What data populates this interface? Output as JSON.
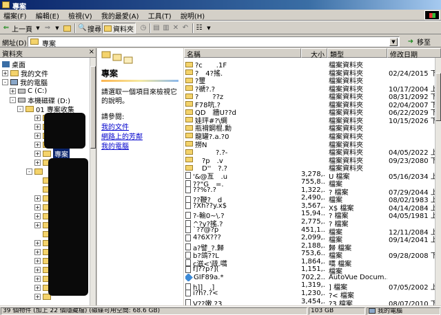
{
  "window": {
    "title": "專案"
  },
  "menu": [
    "檔案(F)",
    "編輯(E)",
    "檢視(V)",
    "我的最愛(A)",
    "工具(T)",
    "說明(H)"
  ],
  "toolbar": {
    "back": "上一頁",
    "search": "搜尋",
    "folders": "資料夾"
  },
  "address": {
    "label": "網址(D)",
    "value": "專案",
    "go": "移至"
  },
  "folder_pane": {
    "title": "資料夾",
    "tree": [
      {
        "label": "桌面",
        "expander": "",
        "selected": false
      },
      {
        "label": "我的文件",
        "expander": "+",
        "selected": false
      },
      {
        "label": "我的電腦",
        "expander": "-",
        "selected": false
      },
      {
        "label": "C (C:)",
        "expander": "+",
        "selected": false
      },
      {
        "label": "本機磁碟 (D:)",
        "expander": "-",
        "selected": false
      },
      {
        "label": "01 專案收集",
        "expander": "-",
        "selected": false
      },
      {
        "label": "專案",
        "expander": "+",
        "selected": true
      }
    ]
  },
  "info_pane": {
    "title": "專案",
    "description": "請選取一個項目來檢視它的說明。",
    "see_also": "請參閱:",
    "links": [
      "我的文件",
      "網路上的芳鄰",
      "我的電腦"
    ]
  },
  "list": {
    "columns": {
      "name": "名稱",
      "size": "大小",
      "type": "類型",
      "modified": "修改日期"
    },
    "rows": [
      {
        "icon": "folder",
        "name": "?c　　.1F",
        "size": "",
        "type": "檔案資料夾",
        "date": ""
      },
      {
        "icon": "folder",
        "name": "?　4?搖.",
        "size": "",
        "type": "檔案資料夾",
        "date": "02/24/2015 下"
      },
      {
        "icon": "folder",
        "name": "?璽",
        "size": "",
        "type": "檔案資料夾",
        "date": ""
      },
      {
        "icon": "folder",
        "name": "?褫?.?",
        "size": "",
        "type": "檔案資料夾",
        "date": "10/17/2004 上"
      },
      {
        "icon": "folder",
        "name": "?　　??z",
        "size": "",
        "type": "檔案資料夾",
        "date": "08/31/2092 下"
      },
      {
        "icon": "folder",
        "name": "F78吭.?",
        "size": "",
        "type": "檔案資料夾",
        "date": "02/04/2007 下"
      },
      {
        "icon": "folder",
        "name": "QD　牆U??d",
        "size": "",
        "type": "檔案資料夾",
        "date": "06/22/2029 下"
      },
      {
        "icon": "folder",
        "name": "娃玶#?\\綢",
        "size": "",
        "type": "檔案資料夾",
        "date": "10/15/2026 下"
      },
      {
        "icon": "folder",
        "name": "瓶褙鋼棍.勳",
        "size": "",
        "type": "檔案資料夾",
        "date": ""
      },
      {
        "icon": "folder",
        "name": "龍罐?.a.?0",
        "size": "",
        "type": "檔案資料夾",
        "date": ""
      },
      {
        "icon": "folder",
        "name": "撈N",
        "size": "",
        "type": "檔案資料夾",
        "date": ""
      },
      {
        "icon": "folder",
        "name": "　　　?.?-",
        "size": "",
        "type": "檔案資料夾",
        "date": "04/05/2022 上"
      },
      {
        "icon": "folder",
        "name": "　?p　.v",
        "size": "",
        "type": "檔案資料夾",
        "date": "09/23/2080 下"
      },
      {
        "icon": "folder",
        "name": "　D''　?.?",
        "size": "",
        "type": "檔案資料夾",
        "date": ""
      },
      {
        "icon": "file",
        "name": "'&@亙　.u",
        "size": "3,278,...",
        "type": "U 檔案",
        "date": "05/16/2034 上"
      },
      {
        "icon": "file",
        "name": "??\"G　=.",
        "size": "755,8...",
        "type": "檔案",
        "date": ""
      },
      {
        "icon": "file",
        "name": "??%?.?",
        "size": "1,322,...",
        "type": "? 檔案",
        "date": "07/29/2044 上"
      },
      {
        "icon": "file",
        "name": "??鞭?　d",
        "size": "2,490,...",
        "type": "檔案",
        "date": "08/02/1983 上"
      },
      {
        "icon": "file",
        "name": "?Xh??y.x$",
        "size": "3,567,...",
        "type": "X$ 檔案",
        "date": "04/14/2084 上"
      },
      {
        "icon": "file",
        "name": "?-輸0~\\.?",
        "size": "15,94...",
        "type": "? 檔案",
        "date": "04/05/1981 上"
      },
      {
        "icon": "file",
        "name": "^?y?搖.?",
        "size": "2,775,...",
        "type": "? 檔案",
        "date": ""
      },
      {
        "icon": "file",
        "name": "`??@?p",
        "size": "451,1...",
        "type": "檔案",
        "date": "12/11/2084 上"
      },
      {
        "icon": "file",
        "name": "4?6X???",
        "size": "2,099,...",
        "type": "檔案",
        "date": "09/14/2041 上"
      },
      {
        "icon": "file",
        "name": "a?譬_?.歸",
        "size": "2,188,...",
        "type": "歸 檔案",
        "date": ""
      },
      {
        "icon": "file",
        "name": "b?鴿??L",
        "size": "753,6...",
        "type": "檔案",
        "date": "09/28/2008 下"
      },
      {
        "icon": "file",
        "name": "c滋<'疏.嚆",
        "size": "1,864,...",
        "type": "嚆 檔案",
        "date": ""
      },
      {
        "icon": "file",
        "name": "f]??p?](",
        "size": "1,151,...",
        "type": "檔案",
        "date": ""
      },
      {
        "icon": "app",
        "name": "GIF89a.*",
        "size": "702,2...",
        "type": "AutoVue Docum...",
        "date": ""
      },
      {
        "icon": "file",
        "name": "h]]　.]",
        "size": "1,319,...",
        "type": "] 檔案",
        "date": "07/05/2002 上"
      },
      {
        "icon": "file",
        "name": "i?h?.?<",
        "size": "1,230,...",
        "type": "?< 檔案",
        "date": ""
      },
      {
        "icon": "file",
        "name": "V??嫩.?3",
        "size": "3,454,...",
        "type": "?3 檔案",
        "date": "08/07/2010 下"
      }
    ]
  },
  "status": {
    "objects": "39 個物件 (加上 22 個隱藏檔) (磁碟可用空間: 68.6 GB)",
    "size": "103 GB",
    "location": "我的電腦"
  }
}
